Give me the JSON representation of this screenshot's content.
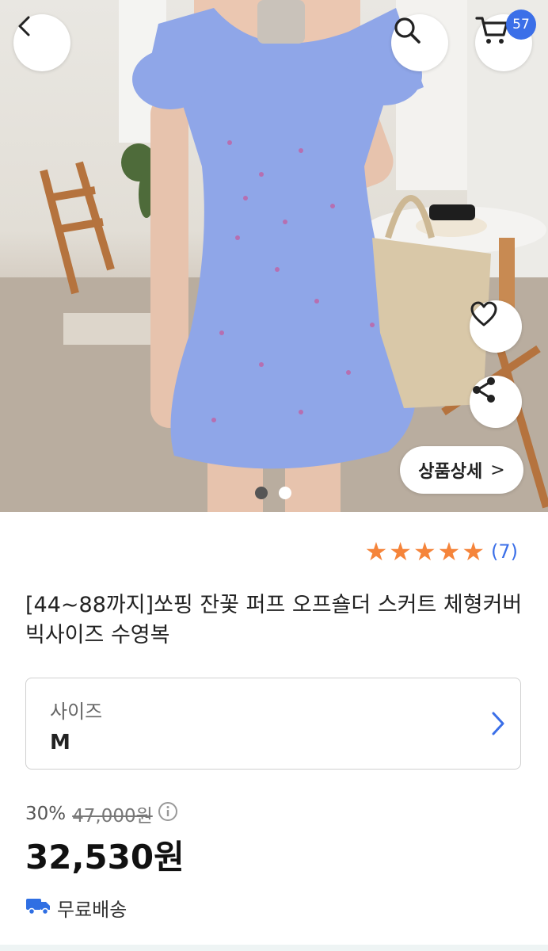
{
  "header": {
    "cart_count": "57"
  },
  "hero": {
    "detail_label": "상품상세",
    "detail_arrow": ">",
    "pagination": {
      "current": 1,
      "total": 2
    }
  },
  "product": {
    "rating_stars": 5,
    "review_count": "(7)",
    "title": "[44~88까지]쏘핑 잔꽃 퍼프 오프숄더 스커트 체형커버 빅사이즈 수영복"
  },
  "option": {
    "label": "사이즈",
    "value": "M"
  },
  "pricing": {
    "discount_rate": "30%",
    "original_price": "47,000원",
    "price": "32,530원"
  },
  "shipping": {
    "label": "무료배송"
  },
  "colors": {
    "accent": "#3b6fe8",
    "star": "#f5843a",
    "dress": "#8fa6e8"
  },
  "icons": [
    "back-arrow-icon",
    "search-icon",
    "cart-icon",
    "heart-icon",
    "share-icon",
    "chevron-right-icon",
    "info-icon",
    "truck-icon"
  ]
}
